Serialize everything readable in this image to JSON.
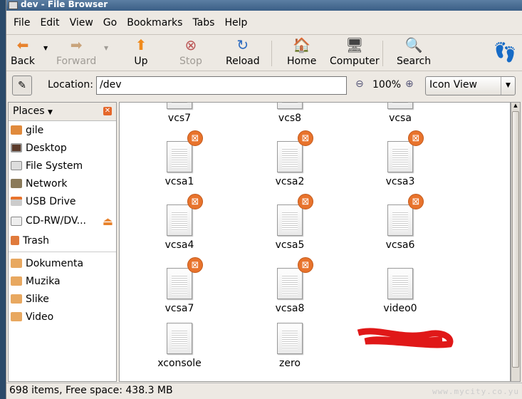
{
  "window": {
    "title": "dev - File Browser"
  },
  "menu": [
    "File",
    "Edit",
    "View",
    "Go",
    "Bookmarks",
    "Tabs",
    "Help"
  ],
  "toolbar": {
    "back": "Back",
    "forward": "Forward",
    "up": "Up",
    "stop": "Stop",
    "reload": "Reload",
    "home": "Home",
    "computer": "Computer",
    "search": "Search"
  },
  "location": {
    "label": "Location:",
    "value": "/dev",
    "zoom": "100%",
    "view": "Icon View"
  },
  "sidebar": {
    "title": "Places",
    "items": [
      "gile",
      "Desktop",
      "File System",
      "Network",
      "USB Drive",
      "CD-RW/DV...",
      "Trash"
    ],
    "bookmarks": [
      "Dokumenta",
      "Muzika",
      "Slike",
      "Video"
    ]
  },
  "files": [
    {
      "name": "vcs7",
      "locked": false
    },
    {
      "name": "vcs8",
      "locked": false
    },
    {
      "name": "vcsa",
      "locked": false
    },
    {
      "name": "vcsa1",
      "locked": true
    },
    {
      "name": "vcsa2",
      "locked": true
    },
    {
      "name": "vcsa3",
      "locked": true
    },
    {
      "name": "vcsa4",
      "locked": true
    },
    {
      "name": "vcsa5",
      "locked": true
    },
    {
      "name": "vcsa6",
      "locked": true
    },
    {
      "name": "vcsa7",
      "locked": true
    },
    {
      "name": "vcsa8",
      "locked": true
    },
    {
      "name": "video0",
      "locked": false
    },
    {
      "name": "xconsole",
      "locked": false
    },
    {
      "name": "zero",
      "locked": false
    }
  ],
  "status": "698 items, Free space: 438.3 MB",
  "watermark": "www.mycity.co.yu"
}
